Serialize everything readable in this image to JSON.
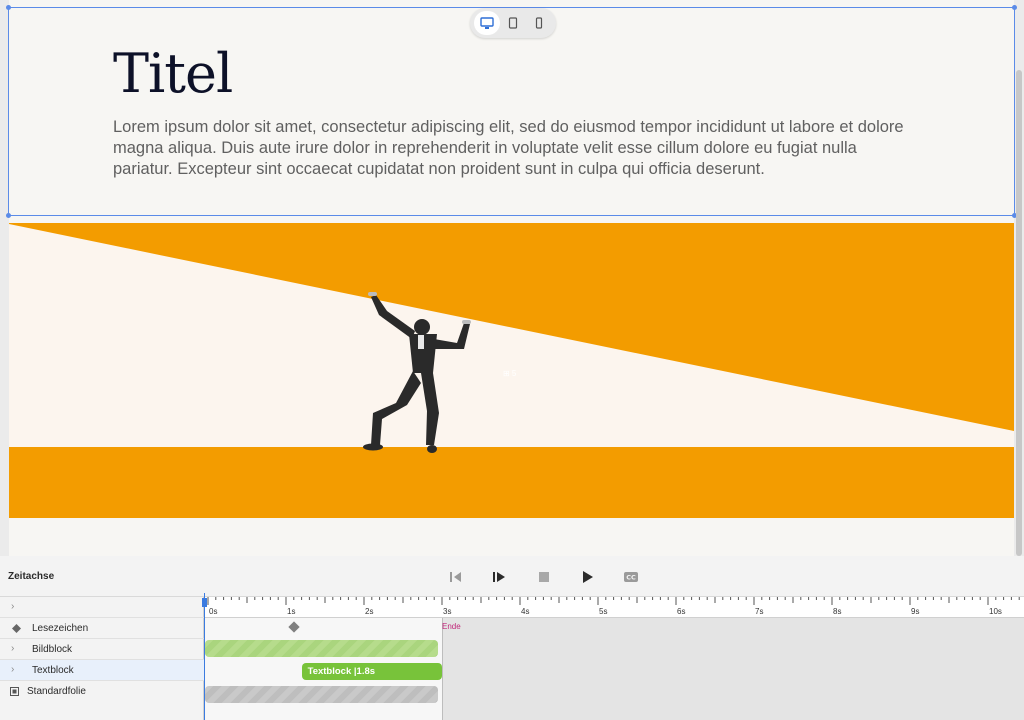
{
  "slide": {
    "title": "Titel",
    "body": "Lorem ipsum dolor sit amet, consectetur adipiscing elit, sed do eiusmod tempor incididunt ut labore et dolore magna aliqua. Duis aute irure dolor in reprehenderit in voluptate velit esse cillum dolore eu fugiat nulla pariatur. Excepteur sint occaecat cupidatat non proident sunt in culpa qui officia deserunt."
  },
  "device_switcher": {
    "options": [
      "desktop-icon",
      "tablet-icon",
      "phone-icon"
    ],
    "selected": "desktop-icon"
  },
  "image_marker": "⊞ 5",
  "colors": {
    "accent_orange": "#f39c00",
    "selection_blue": "#5b8be8",
    "bar_green": "#78c33a",
    "end_magenta": "#c0287a"
  },
  "timeline": {
    "label": "Zeitachse",
    "controls": [
      "step-back-icon",
      "play-from-start-icon",
      "stop-icon",
      "play-icon",
      "closed-captions-icon"
    ],
    "ticks": [
      "0s",
      "1s",
      "2s",
      "3s",
      "4s",
      "5s",
      "6s",
      "7s",
      "8s",
      "9s",
      "10s"
    ],
    "end_label": "Ende",
    "tracks": [
      {
        "label": "Lesezeichen",
        "icon": "bookmark-diamond-icon"
      },
      {
        "label": "Bildblock",
        "icon": "chevron-right-icon"
      },
      {
        "label": "Textblock",
        "icon": "chevron-right-icon"
      },
      {
        "label": "Standardfolie",
        "icon": "slide-icon"
      }
    ],
    "textblock_bar": "Textblock  |1.8s",
    "bookmark_time_s": 1.1,
    "slide_duration_s": 3,
    "textblock_start_s": 1.2
  }
}
